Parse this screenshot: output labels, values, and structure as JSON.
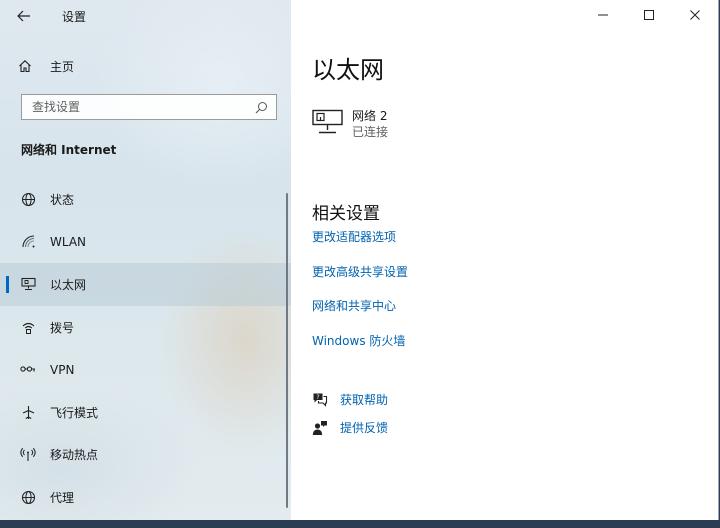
{
  "window": {
    "title": "设置",
    "caption": {
      "minimize": "minimize-icon",
      "maximize": "maximize-icon",
      "close": "close-icon"
    }
  },
  "sidebar": {
    "home_label": "主页",
    "search": {
      "placeholder": "查找设置",
      "value": ""
    },
    "section_heading": "网络和 Internet",
    "items": [
      {
        "label": "状态",
        "icon": "globe-status-icon",
        "selected": false
      },
      {
        "label": "WLAN",
        "icon": "wifi-icon",
        "selected": false
      },
      {
        "label": "以太网",
        "icon": "ethernet-icon",
        "selected": true
      },
      {
        "label": "拨号",
        "icon": "dialup-icon",
        "selected": false
      },
      {
        "label": "VPN",
        "icon": "vpn-icon",
        "selected": false
      },
      {
        "label": "飞行模式",
        "icon": "airplane-icon",
        "selected": false
      },
      {
        "label": "移动热点",
        "icon": "hotspot-icon",
        "selected": false
      },
      {
        "label": "代理",
        "icon": "globe-icon",
        "selected": false
      }
    ]
  },
  "main": {
    "title": "以太网",
    "network": {
      "name": "网络 2",
      "status": "已连接"
    },
    "related_settings": {
      "title": "相关设置",
      "links": [
        "更改适配器选项",
        "更改高级共享设置",
        "网络和共享中心",
        "Windows 防火墙"
      ]
    },
    "help": {
      "get_help": "获取帮助",
      "feedback": "提供反馈"
    }
  },
  "colors": {
    "accent": "#0067c0",
    "link": "#0063b1"
  }
}
